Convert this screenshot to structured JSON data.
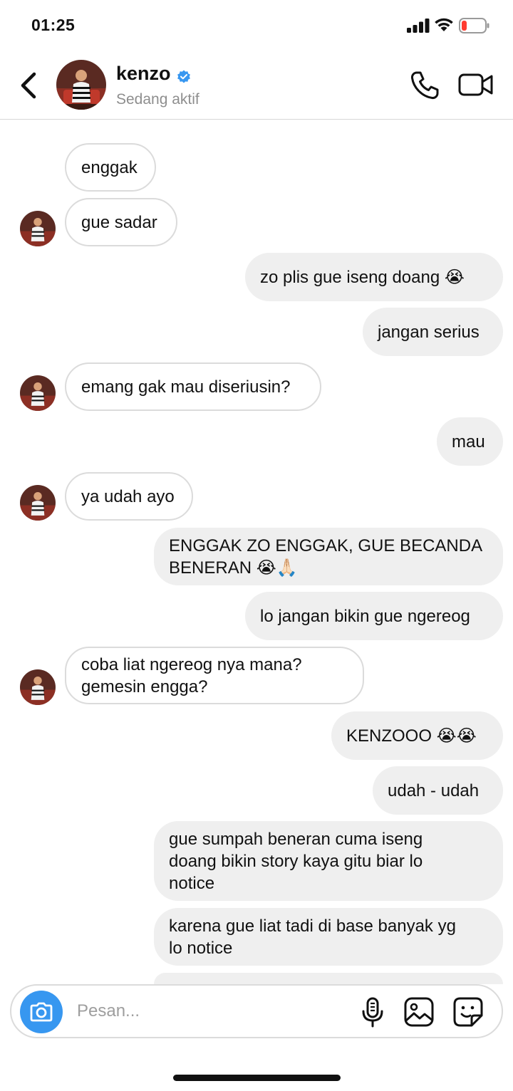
{
  "status_bar": {
    "time": "01:25"
  },
  "header": {
    "contact_name": "kenzo",
    "contact_status": "Sedang aktif"
  },
  "messages": [
    {
      "from": "them",
      "text": "enggak"
    },
    {
      "from": "them",
      "text": "gue sadar"
    },
    {
      "from": "me",
      "text": "zo plis gue iseng doang 😭"
    },
    {
      "from": "me",
      "text": "jangan serius"
    },
    {
      "from": "them",
      "text": "emang gak mau diseriusin?"
    },
    {
      "from": "me",
      "text": "mau"
    },
    {
      "from": "them",
      "text": "ya udah ayo"
    },
    {
      "from": "me",
      "text": "ENGGAK ZO ENGGAK, GUE BECANDA\nBENERAN 😭🙏🏻"
    },
    {
      "from": "me",
      "text": "lo jangan bikin gue ngereog"
    },
    {
      "from": "them",
      "text": "coba liat ngereog nya mana?\ngemesin engga?"
    },
    {
      "from": "me",
      "text": "KENZOOO 😭😭"
    },
    {
      "from": "me",
      "text": "udah - udah"
    },
    {
      "from": "me",
      "text": "gue sumpah beneran cuma iseng\ndoang bikin story kaya gitu biar lo\nnotice"
    },
    {
      "from": "me",
      "text": "karena gue liat tadi di base banyak yg\nlo notice"
    }
  ],
  "composer": {
    "placeholder": "Pesan..."
  },
  "icons": {
    "back": "chevron-left-icon",
    "verified": "verified-badge-icon",
    "call": "phone-icon",
    "video": "video-camera-icon",
    "camera": "camera-icon",
    "mic": "microphone-icon",
    "gallery": "image-icon",
    "sticker": "sticker-icon"
  },
  "colors": {
    "accent": "#3797f0",
    "verified": "#3897f0",
    "outgoing_bubble": "#efefef",
    "incoming_border": "#dbdbdb",
    "battery_low": "#ff3b30"
  }
}
